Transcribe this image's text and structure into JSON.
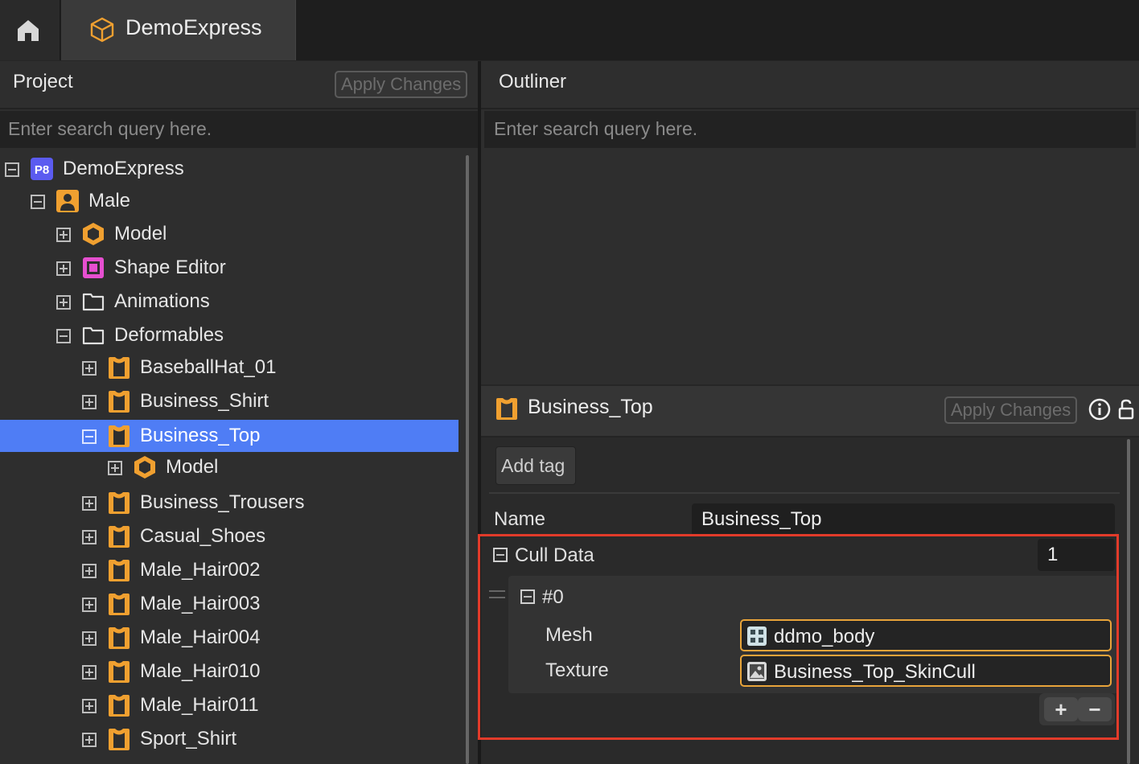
{
  "tabs": {
    "home_icon": "home-icon",
    "active_tab_label": "DemoExpress",
    "active_tab_icon": "cube-icon"
  },
  "project": {
    "title": "Project",
    "apply_label": "Apply Changes",
    "search_placeholder": "Enter search query here.",
    "tree": [
      {
        "label": "DemoExpress",
        "icon": "p8-project-icon",
        "expanded": true
      },
      {
        "label": "Male",
        "icon": "character-icon",
        "expanded": true
      },
      {
        "label": "Model",
        "icon": "model-hex-icon",
        "expanded": false
      },
      {
        "label": "Shape Editor",
        "icon": "shape-editor-icon",
        "expanded": false
      },
      {
        "label": "Animations",
        "icon": "folder-icon",
        "expanded": false
      },
      {
        "label": "Deformables",
        "icon": "folder-icon",
        "expanded": true
      },
      {
        "label": "BaseballHat_01",
        "icon": "shirt-icon",
        "expanded": false
      },
      {
        "label": "Business_Shirt",
        "icon": "shirt-icon",
        "expanded": false
      },
      {
        "label": "Business_Top",
        "icon": "shirt-icon",
        "expanded": true,
        "selected": true
      },
      {
        "label": "Model",
        "icon": "model-hex-icon",
        "expanded": false
      },
      {
        "label": "Business_Trousers",
        "icon": "shirt-icon",
        "expanded": false
      },
      {
        "label": "Casual_Shoes",
        "icon": "shirt-icon",
        "expanded": false
      },
      {
        "label": "Male_Hair002",
        "icon": "shirt-icon",
        "expanded": false
      },
      {
        "label": "Male_Hair003",
        "icon": "shirt-icon",
        "expanded": false
      },
      {
        "label": "Male_Hair004",
        "icon": "shirt-icon",
        "expanded": false
      },
      {
        "label": "Male_Hair010",
        "icon": "shirt-icon",
        "expanded": false
      },
      {
        "label": "Male_Hair011",
        "icon": "shirt-icon",
        "expanded": false
      },
      {
        "label": "Sport_Shirt",
        "icon": "shirt-icon",
        "expanded": false
      }
    ]
  },
  "outliner": {
    "title": "Outliner",
    "search_placeholder": "Enter search query here."
  },
  "inspector": {
    "title": "Business_Top",
    "apply_label": "Apply Changes",
    "add_tag_label": "Add tag",
    "name_label": "Name",
    "name_value": "Business_Top",
    "cull_data_label": "Cull Data",
    "cull_data_count": "1",
    "item_label": "#0",
    "mesh_label": "Mesh",
    "mesh_value": "ddmo_body",
    "texture_label": "Texture",
    "texture_value": "Business_Top_SkinCull",
    "add_symbol": "+",
    "remove_symbol": "−"
  },
  "colors": {
    "selection": "#4f7df5",
    "accent_orange": "#f0a030",
    "highlight_red": "#e23b2a"
  }
}
